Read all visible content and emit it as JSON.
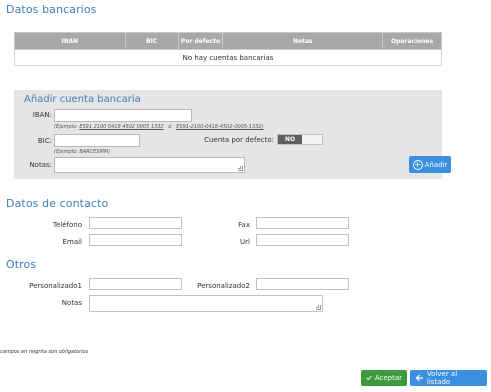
{
  "bank": {
    "title": "Datos bancarios",
    "columns": [
      "IBAN",
      "BIC",
      "Por defecto",
      "Notas",
      "Operaciones"
    ],
    "empty_message": "No hay cuentas bancarias"
  },
  "add_account": {
    "title": "Añadir cuenta bancaria",
    "iban_label": "IBAN:",
    "iban_example_prefix": "(Ejemplo: ",
    "iban_example_1": "ES91 2100 0418 4502 0005 1332",
    "iban_example_sep": "ó",
    "iban_example_2": "ES91-2100-0418-4502-0005-1332)",
    "bic_label": "BIC:",
    "bic_example": "(Ejemplo: BARCESMM)",
    "default_label": "Cuenta por defecto:",
    "default_value": "NO",
    "notes_label": "Notas:",
    "add_button": "Añadir"
  },
  "contact": {
    "title": "Datos de contacto",
    "phone_label": "Teléfono",
    "fax_label": "Fax",
    "email_label": "Email",
    "url_label": "Url"
  },
  "other": {
    "title": "Otros",
    "custom1_label": "Personalizado1",
    "custom2_label": "Personalizado2",
    "notes_label": "Notas"
  },
  "footer": {
    "required_note": "campos en negrita son obligatorios",
    "accept_label": "Aceptar",
    "back_label": "Volver al listado"
  },
  "colors": {
    "heading": "#3f7dbf",
    "accept": "#3f9a3f",
    "primary": "#3a8fe1",
    "table_header": "#a8a8a8",
    "panel": "#e5e5e5"
  },
  "icons": {
    "add": "plus-circle-icon",
    "accept": "check-icon",
    "back": "arrow-left-icon"
  }
}
